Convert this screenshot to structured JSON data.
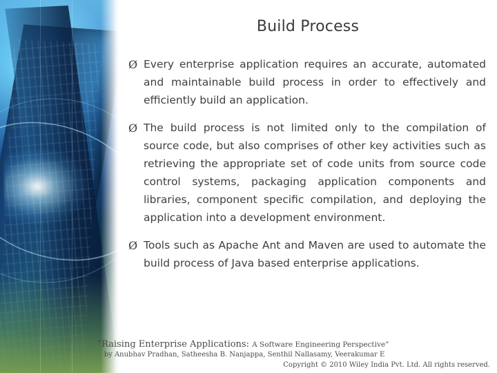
{
  "slide": {
    "title": "Build Process",
    "bullet_marker": "Ø",
    "bullets": [
      "Every enterprise application requires an accurate, automated and maintainable build process in order to effectively and efficiently build an application.",
      "The build process is not limited only to the compilation of source code, but also comprises of other key activities such as retrieving the appropriate set of code units from source code control systems, packaging application components and libraries, component specific compilation, and deploying the application into a development environment.",
      "Tools such as Apache Ant and Maven are used to automate the build process of Java based enterprise applications."
    ],
    "footer": {
      "book_title_main": "“Raising Enterprise Applications:",
      "book_title_sub": "A Software Engineering Perspective”",
      "authors": "by Anubhav Pradhan, Satheesha B. Nanjappa, Senthil Nallasamy, Veerakumar E",
      "copyright": "Copyright © 2010 Wiley India Pvt. Ltd.  All rights reserved."
    }
  },
  "colors": {
    "title": "#3a3a3a",
    "body": "#3f3f3f",
    "footer": "#4a4a4a"
  }
}
